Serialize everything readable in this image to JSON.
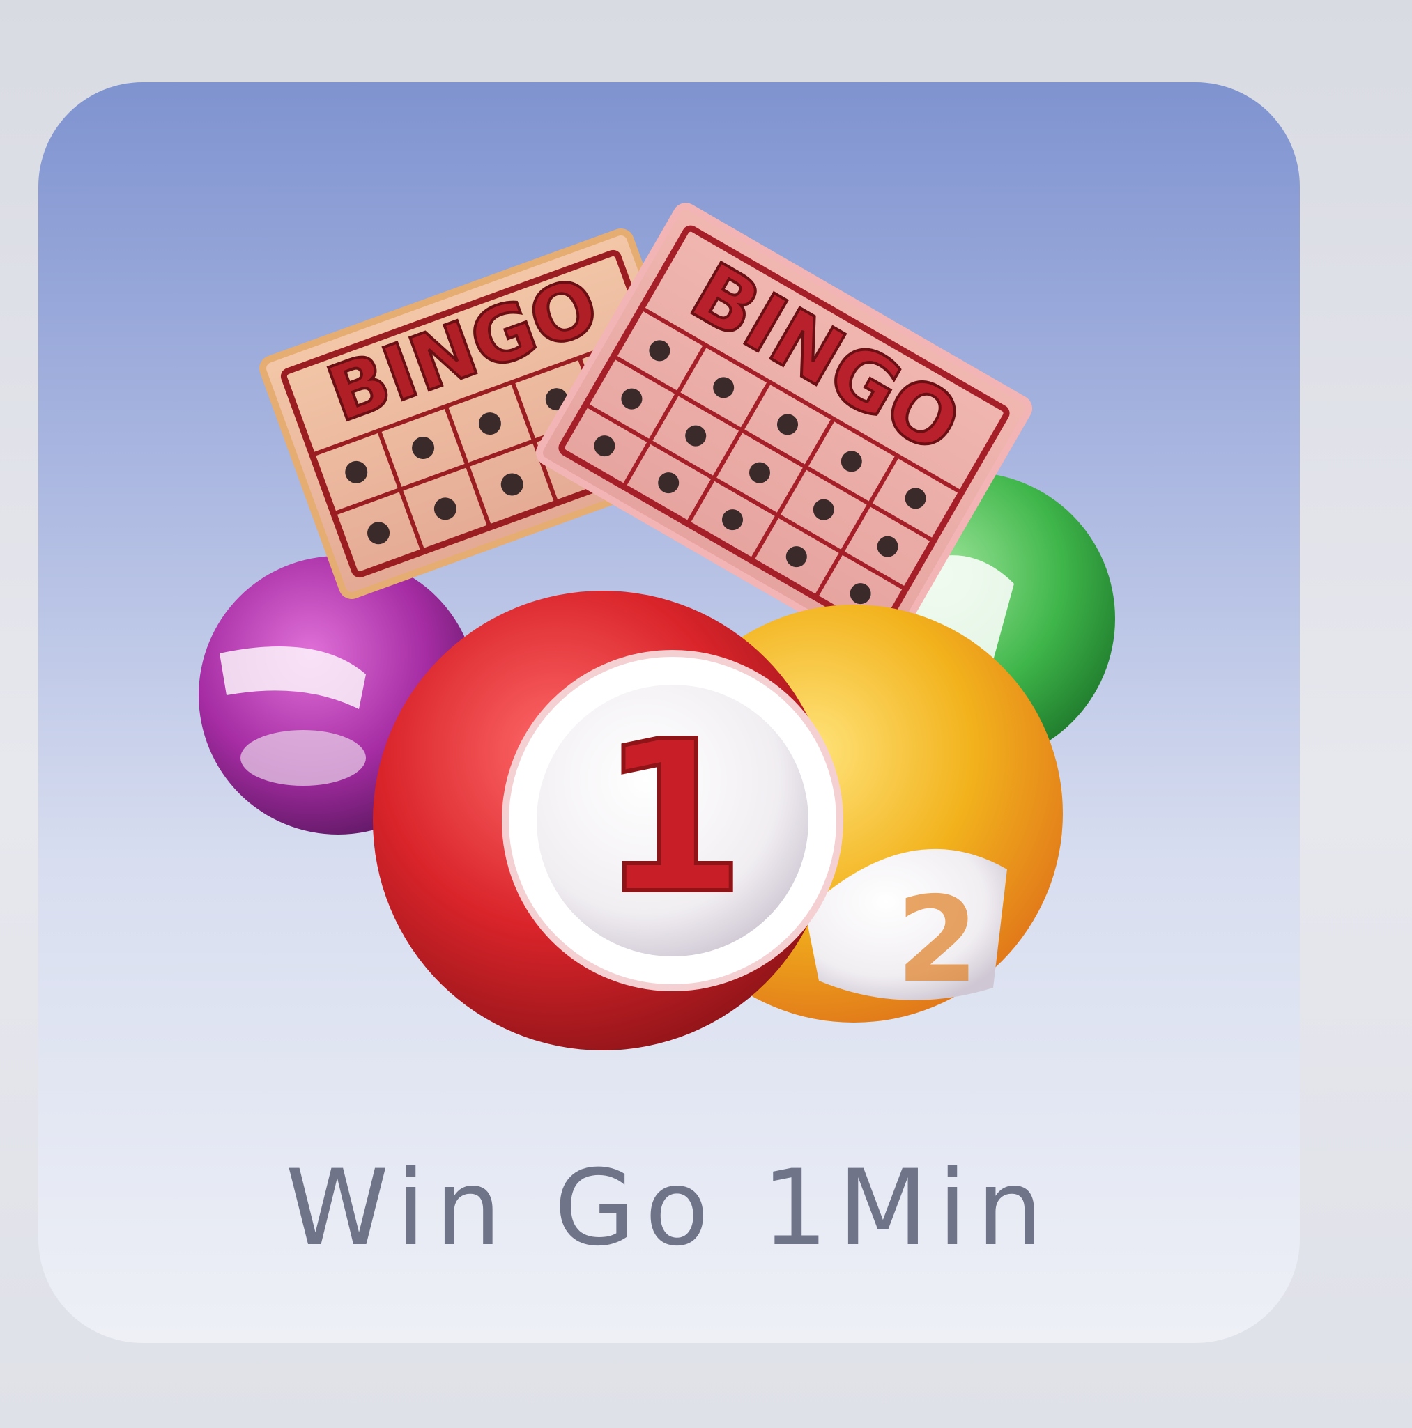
{
  "game_tile": {
    "label": "Win Go 1Min",
    "icon": "bingo-balls-and-cards-icon",
    "card_text": "BINGO",
    "ball_number": "1"
  },
  "colors": {
    "tile_top": "#7f93d0",
    "tile_bottom": "#eef0f6",
    "label": "#6f7488",
    "red_ball": "#d9242a",
    "yellow_ball": "#f2b21c",
    "green_ball": "#3fb64a",
    "purple_ball": "#a52ca3",
    "card": "#e9b79e",
    "card_print": "#9a1d22"
  }
}
